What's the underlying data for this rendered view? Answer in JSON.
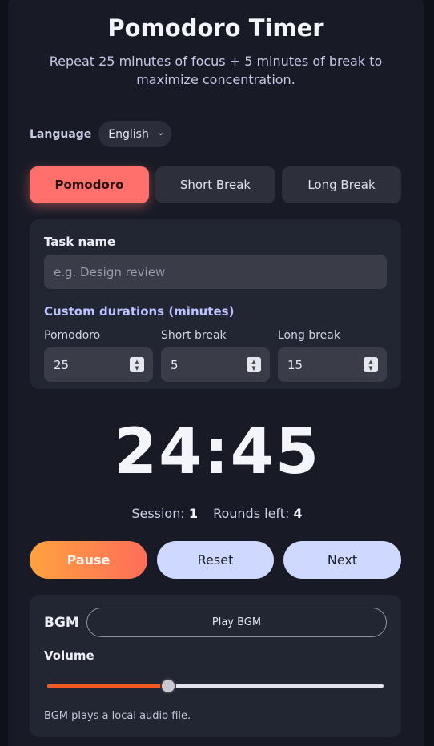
{
  "header": {
    "title": "Pomodoro Timer",
    "subtitle": "Repeat 25 minutes of focus + 5 minutes of break to maximize concentration."
  },
  "language": {
    "label": "Language",
    "selected": "English"
  },
  "modes": [
    {
      "label": "Pomodoro",
      "active": true
    },
    {
      "label": "Short Break",
      "active": false
    },
    {
      "label": "Long Break",
      "active": false
    }
  ],
  "task": {
    "label": "Task name",
    "placeholder": "e.g. Design review"
  },
  "durations": {
    "title": "Custom durations (minutes)",
    "fields": [
      {
        "label": "Pomodoro",
        "value": "25"
      },
      {
        "label": "Short break",
        "value": "5"
      },
      {
        "label": "Long break",
        "value": "15"
      }
    ]
  },
  "timer": {
    "display": "24:45"
  },
  "status": {
    "session_label": "Session:",
    "session_value": "1",
    "rounds_label": "Rounds left:",
    "rounds_value": "4"
  },
  "controls": {
    "pause": "Pause",
    "reset": "Reset",
    "next": "Next"
  },
  "bgm": {
    "title": "BGM",
    "play_label": "Play BGM",
    "volume_label": "Volume",
    "volume_fraction": 0.36,
    "note": "BGM plays a local audio file."
  },
  "colors": {
    "accent": "#ff6f6c",
    "primary_gradient_start": "#ffa23e",
    "primary_gradient_end": "#ff6d5a",
    "secondary": "#cfd8ff",
    "slider_fill": "#f25a1f"
  }
}
